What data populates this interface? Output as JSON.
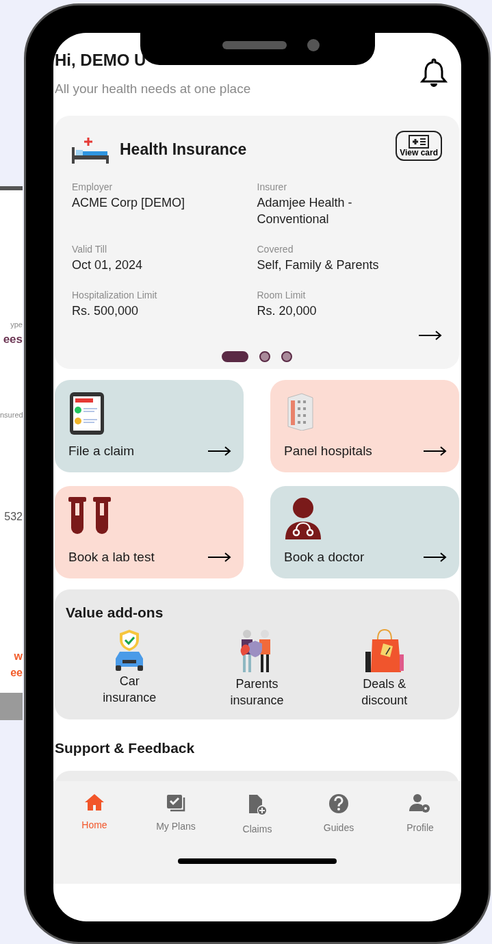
{
  "back_phone": {
    "texts": [
      {
        "text": "ype",
        "kind": "label"
      },
      {
        "text": "ees",
        "kind": "value"
      },
      {
        "text": "nsured",
        "kind": "label"
      },
      {
        "text": "532",
        "kind": "number"
      },
      {
        "text": "w",
        "kind": "accent"
      },
      {
        "text": "ee",
        "kind": "accent"
      }
    ]
  },
  "header": {
    "greeting": "Hi, DEMO U",
    "subtitle": "All your health needs at one place"
  },
  "insurance_card": {
    "title": "Health Insurance",
    "view_card": "View card",
    "fields": [
      {
        "label": "Employer",
        "value": "ACME Corp [DEMO]"
      },
      {
        "label": "Insurer",
        "value": "Adamjee Health - Conventional"
      },
      {
        "label": "Valid Till",
        "value": "Oct 01, 2024"
      },
      {
        "label": "Covered",
        "value": "Self, Family & Parents"
      },
      {
        "label": "Hospitalization Limit",
        "value": "Rs. 500,000"
      },
      {
        "label": "Room Limit",
        "value": "Rs. 20,000"
      }
    ]
  },
  "carousel": [
    {
      "selected": true
    },
    {
      "selected": false
    },
    {
      "selected": false
    }
  ],
  "tiles": [
    {
      "label": "File a claim",
      "kind": "claim",
      "color": "#d3e1e2"
    },
    {
      "label": "Panel hospitals",
      "kind": "hospital",
      "color": "#fcdcd3"
    },
    {
      "label": "Book a lab test",
      "kind": "lab",
      "color": "#fcdcd3"
    },
    {
      "label": "Book a doctor",
      "kind": "doctor",
      "color": "#d3e1e2"
    }
  ],
  "value_addons": {
    "title": "Value add-ons",
    "items": [
      {
        "label": "Car insurance",
        "kind": "car"
      },
      {
        "label": "Parents insurance",
        "kind": "parents"
      },
      {
        "label": "Deals & discount",
        "kind": "deals"
      }
    ]
  },
  "support": {
    "title": "Support & Feedback"
  },
  "nav": [
    {
      "label": "Home",
      "kind": "home",
      "selected": true
    },
    {
      "label": "My Plans",
      "kind": "plans",
      "selected": false
    },
    {
      "label": "Claims",
      "kind": "claims",
      "selected": false
    },
    {
      "label": "Guides",
      "kind": "guides",
      "selected": false
    },
    {
      "label": "Profile",
      "kind": "profile",
      "selected": false
    }
  ]
}
